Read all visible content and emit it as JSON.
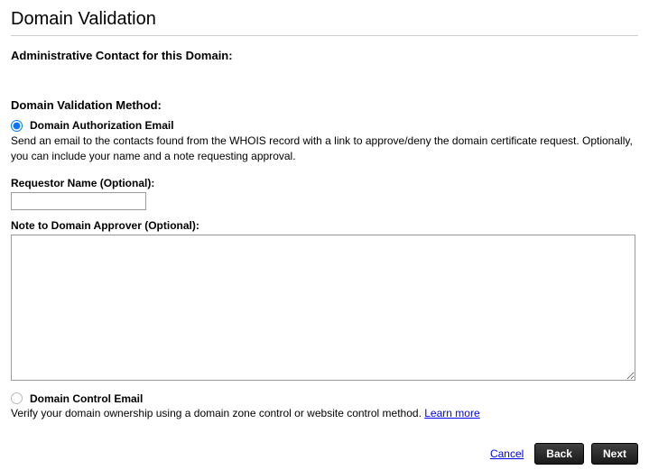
{
  "title": "Domain Validation",
  "admin_contact_heading": "Administrative Contact for this Domain:",
  "method_heading": "Domain Validation Method:",
  "method1": {
    "label": "Domain Authorization Email",
    "desc": "Send an email to the contacts found from the WHOIS record with a link to approve/deny the domain certificate request. Optionally, you can include your name and a note requesting approval."
  },
  "requestor_label": "Requestor Name (Optional):",
  "requestor_value": "",
  "note_label": "Note to Domain Approver (Optional):",
  "note_value": "",
  "method2": {
    "label": "Domain Control Email",
    "desc": "Verify your domain ownership using a domain zone control or website control method. ",
    "learn_more": "Learn more"
  },
  "buttons": {
    "cancel": "Cancel",
    "back": "Back",
    "next": "Next"
  }
}
